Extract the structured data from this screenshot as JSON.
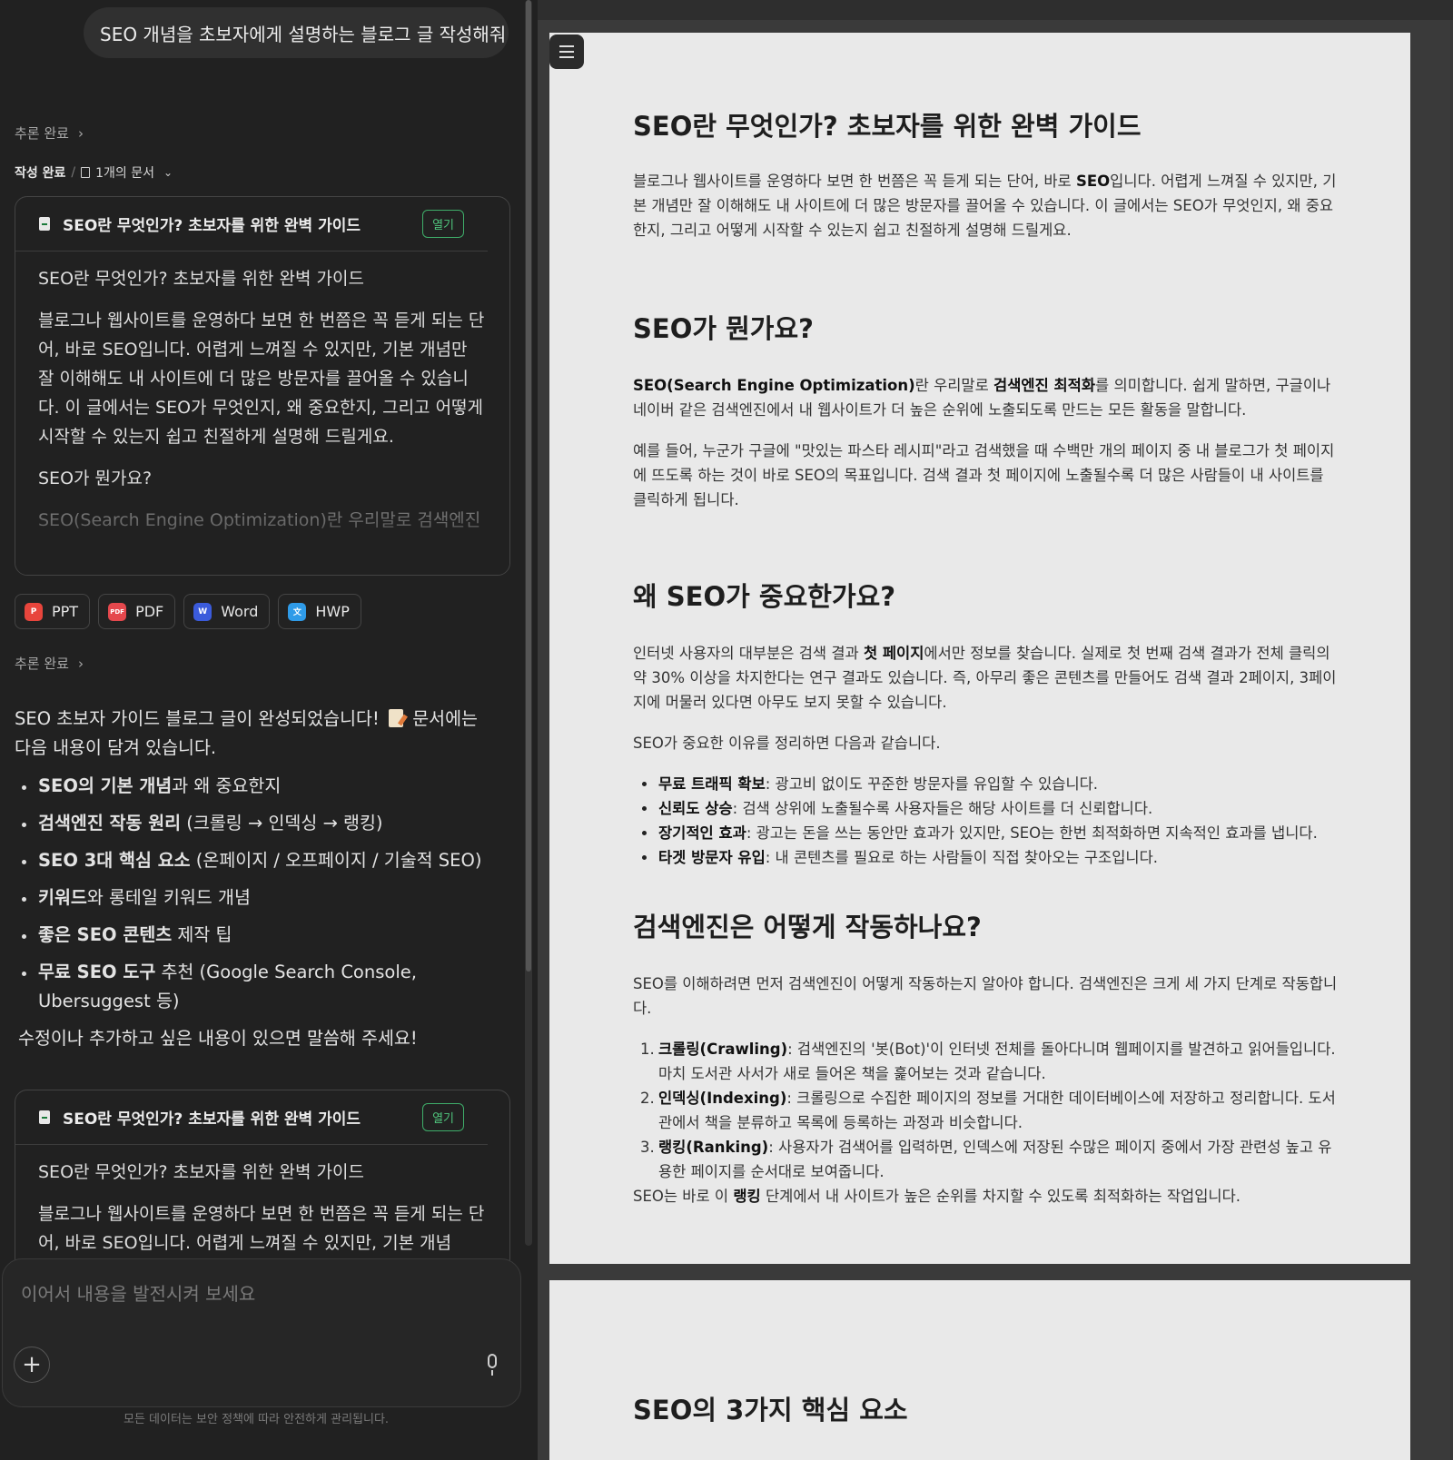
{
  "chat": {
    "user_message": "SEO 개념을 초보자에게 설명하는 블로그 글 작성해줘",
    "reasoning_done_label": "추론 완료",
    "writing_done_label": "작성 완료",
    "doc_count_label": "1개의 문서",
    "doc_card": {
      "title": "SEO란 무엇인가? 초보자를 위한 완벽 가이드",
      "open_label": "열기",
      "preview_heading": "SEO란 무엇인가? 초보자를 위한 완벽 가이드",
      "preview_p1": "블로그나 웹사이트를 운영하다 보면 한 번쯤은 꼭 듣게 되는 단어, 바로 SEO입니다. 어렵게 느껴질 수 있지만, 기본 개념만 잘 이해해도 내 사이트에 더 많은 방문자를 끌어올 수 있습니다. 이 글에서는 SEO가 무엇인지, 왜 중요한지, 그리고 어떻게 시작할 수 있는지 쉽고 친절하게 설명해 드릴게요.",
      "preview_h2": "SEO가 뭔가요?",
      "preview_fade": "SEO(Search Engine Optimization)란 우리말로 검색엔진",
      "preview_p1_short": "블로그나 웹사이트를 운영하다 보면 한 번쯤은 꼭 듣게 되는 단어, 바로 SEO입니다. 어렵게 느껴질 수 있지만, 기본 개념"
    },
    "exports": [
      {
        "label": "PPT",
        "icon": "ppt-icon",
        "color": "#e8453c",
        "glyph": "P"
      },
      {
        "label": "PDF",
        "icon": "pdf-icon",
        "color": "#e5484d",
        "glyph": "PDF"
      },
      {
        "label": "Word",
        "icon": "word-icon",
        "color": "#3b5bdb",
        "glyph": "W"
      },
      {
        "label": "HWP",
        "icon": "hwp-icon",
        "color": "#2f9be8",
        "glyph": "文"
      }
    ],
    "assistant_intro_1": "SEO 초보자 가이드 블로그 글이 완성되었습니다!",
    "assistant_intro_2": "문서에는 다음 내용이 담겨 있습니다.",
    "bullets": [
      {
        "bold": "SEO의 기본 개념",
        "rest": "과 왜 중요한지"
      },
      {
        "bold": "검색엔진 작동 원리",
        "rest": " (크롤링 → 인덱싱 → 랭킹)"
      },
      {
        "bold": "SEO 3대 핵심 요소",
        "rest": " (온페이지 / 오프페이지 / 기술적 SEO)"
      },
      {
        "bold": "키워드",
        "rest": "와 롱테일 키워드 개념"
      },
      {
        "bold": "좋은 SEO 콘텐츠",
        "rest": " 제작 팁"
      },
      {
        "bold": "무료 SEO 도구",
        "rest": " 추천 (Google Search Console, Ubersuggest 등)"
      }
    ],
    "closing": "수정이나 추가하고 싶은 내용이 있으면 말씀해 주세요!",
    "composer_placeholder": "이어서 내용을 발전시켜 보세요",
    "footnote": "모든 데이터는 보안 정책에 따라 안전하게 관리됩니다."
  },
  "document": {
    "title": "SEO란 무엇인가? 초보자를 위한 완벽 가이드",
    "intro": {
      "a": "블로그나 웹사이트를 운영하다 보면 한 번쯤은 꼭 듣게 되는 단어, 바로 ",
      "b": "SEO",
      "c": "입니다. 어렵게 느껴질 수 있지만, 기본 개념만 잘 이해해도 내 사이트에 더 많은 방문자를 끌어올 수 있습니다. 이 글에서는 SEO가 무엇인지, 왜 중요한지, 그리고 어떻게 시작할 수 있는지 쉽고 친절하게 설명해 드릴게요."
    },
    "s1_title": "SEO가 뭔가요?",
    "s1_p1": {
      "a": "SEO(Search Engine Optimization)",
      "b": "란 우리말로 ",
      "c": "검색엔진 최적화",
      "d": "를 의미합니다. 쉽게 말하면, 구글이나 네이버 같은 검색엔진에서 내 웹사이트가 더 높은 순위에 노출되도록 만드는 모든 활동을 말합니다."
    },
    "s1_p2": "예를 들어, 누군가 구글에 \"맛있는 파스타 레시피\"라고 검색했을 때 수백만 개의 페이지 중 내 블로그가 첫 페이지에 뜨도록 하는 것이 바로 SEO의 목표입니다. 검색 결과 첫 페이지에 노출될수록 더 많은 사람들이 내 사이트를 클릭하게 됩니다.",
    "s2_title": "왜 SEO가 중요한가요?",
    "s2_p1": {
      "a": "인터넷 사용자의 대부분은 검색 결과 ",
      "b": "첫 페이지",
      "c": "에서만 정보를 찾습니다. 실제로 첫 번째 검색 결과가 전체 클릭의 약 30% 이상을 차지한다는 연구 결과도 있습니다. 즉, 아무리 좋은 콘텐츠를 만들어도 검색 결과 2페이지, 3페이지에 머물러 있다면 아무도 보지 못할 수 있습니다."
    },
    "s2_p2": "SEO가 중요한 이유를 정리하면 다음과 같습니다.",
    "s2_list": [
      {
        "bold": "무료 트래픽 확보",
        "rest": ": 광고비 없이도 꾸준한 방문자를 유입할 수 있습니다."
      },
      {
        "bold": "신뢰도 상승",
        "rest": ": 검색 상위에 노출될수록 사용자들은 해당 사이트를 더 신뢰합니다."
      },
      {
        "bold": "장기적인 효과",
        "rest": ": 광고는 돈을 쓰는 동안만 효과가 있지만, SEO는 한번 최적화하면 지속적인 효과를 냅니다."
      },
      {
        "bold": "타겟 방문자 유입",
        "rest": ": 내 콘텐츠를 필요로 하는 사람들이 직접 찾아오는 구조입니다."
      }
    ],
    "s3_title": "검색엔진은 어떻게 작동하나요?",
    "s3_p1": "SEO를 이해하려면 먼저 검색엔진이 어떻게 작동하는지 알아야 합니다. 검색엔진은 크게 세 가지 단계로 작동합니다.",
    "s3_list": [
      {
        "num": "1.",
        "bold": "크롤링(Crawling)",
        "rest": ": 검색엔진의 '봇(Bot)'이 인터넷 전체를 돌아다니며 웹페이지를 발견하고 읽어들입니다. 마치 도서관 사서가 새로 들어온 책을 훑어보는 것과 같습니다."
      },
      {
        "num": "2.",
        "bold": "인덱싱(Indexing)",
        "rest": ": 크롤링으로 수집한 페이지의 정보를 거대한 데이터베이스에 저장하고 정리합니다. 도서관에서 책을 분류하고 목록에 등록하는 과정과 비슷합니다."
      },
      {
        "num": "3.",
        "bold": "랭킹(Ranking)",
        "rest": ": 사용자가 검색어를 입력하면, 인덱스에 저장된 수많은 페이지 중에서 가장 관련성 높고 유용한 페이지를 순서대로 보여줍니다."
      }
    ],
    "s3_after": {
      "a": "SEO는 바로 이 ",
      "b": "랭킹",
      "c": " 단계에서 내 사이트가 높은 순위를 차지할 수 있도록 최적화하는 작업입니다."
    },
    "s4_title": "SEO의 3가지 핵심 요소"
  }
}
